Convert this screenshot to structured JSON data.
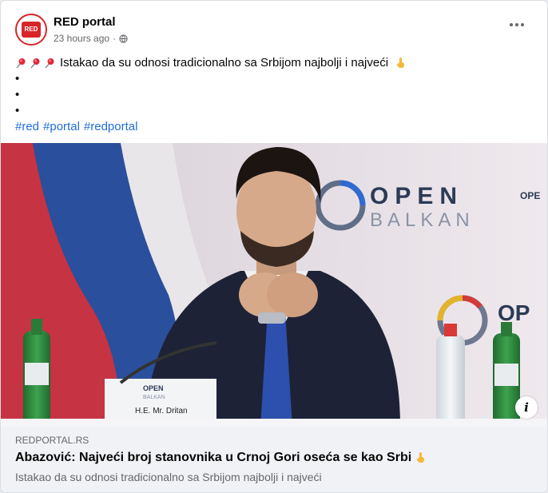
{
  "post": {
    "page_name": "RED portal",
    "avatar_text": "Red portal",
    "time": "23 hours ago",
    "separator": "·",
    "more_icon": "more-horizontal-icon",
    "audience_icon": "globe-icon",
    "text_main": "Istakao da su odnosi tradicionalno sa Srbijom najbolji i najveći",
    "leading_icons": [
      "pushpin-icon",
      "pushpin-icon",
      "pushpin-icon"
    ],
    "trailing_icon": "pointing-hand-icon",
    "bullets": [
      "",
      "",
      ""
    ],
    "hashtags": [
      "#red",
      "#portal",
      "#redportal"
    ]
  },
  "image": {
    "description_icon": "info-icon",
    "info_label": "i",
    "photo_texts": {
      "logo_line1": "OPEN",
      "logo_line2": "BALKAN",
      "nameplate": "H.E. Mr. Dritan",
      "nameplate_logo_line1": "OPEN",
      "nameplate_logo_line2": "BALKAN"
    }
  },
  "link": {
    "domain": "REDPORTAL.RS",
    "title": "Abazović: Najveći broj stanovnika u Crnoj Gori oseća se kao Srbi",
    "description": "Istakao da su odnosi tradicionalno sa Srbijom najbolji i najveći"
  },
  "colors": {
    "brand_red": "#d9252a",
    "hashtag_blue": "#216fdb",
    "secondary_text": "#65676b",
    "link_box_bg": "#f0f2f5"
  }
}
